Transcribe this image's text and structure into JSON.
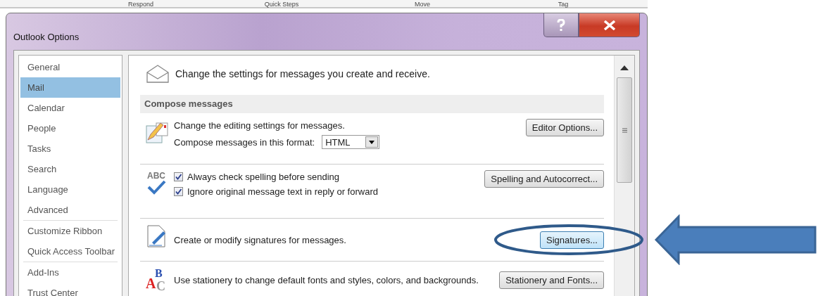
{
  "ribbon_groups": [
    "Respond",
    "Quick Steps",
    "Move",
    "Tag"
  ],
  "window": {
    "title": "Outlook Options"
  },
  "sidebar": {
    "groups": [
      [
        {
          "label": "General",
          "selected": false
        },
        {
          "label": "Mail",
          "selected": true
        },
        {
          "label": "Calendar",
          "selected": false
        },
        {
          "label": "People",
          "selected": false
        },
        {
          "label": "Tasks",
          "selected": false
        },
        {
          "label": "Search",
          "selected": false
        },
        {
          "label": "Language",
          "selected": false
        },
        {
          "label": "Advanced",
          "selected": false
        }
      ],
      [
        {
          "label": "Customize Ribbon",
          "selected": false
        },
        {
          "label": "Quick Access Toolbar",
          "selected": false
        }
      ],
      [
        {
          "label": "Add-Ins",
          "selected": false
        },
        {
          "label": "Trust Center",
          "selected": false
        }
      ]
    ]
  },
  "header": "Change the settings for messages you create and receive.",
  "section": "Compose messages",
  "rows": [
    {
      "lines": [
        {
          "kind": "text",
          "text": "Change the editing settings for messages."
        },
        {
          "kind": "select",
          "label": "Compose messages in this format:",
          "value": "HTML"
        }
      ],
      "button": {
        "label": "Editor Options...",
        "circled": false
      }
    },
    {
      "icon_letters": [
        "ABC"
      ],
      "lines": [
        {
          "kind": "checkbox",
          "label": "Always check spelling before sending",
          "checked": true
        },
        {
          "kind": "checkbox",
          "label": "Ignore original message text in reply or forward",
          "checked": true
        }
      ],
      "button": {
        "label": "Spelling and Autocorrect...",
        "circled": false
      }
    },
    {
      "lines": [
        {
          "kind": "text",
          "text": "Create or modify signatures for messages."
        }
      ],
      "button": {
        "label": "Signatures...",
        "circled": true
      }
    },
    {
      "icon_letters": [
        "B",
        "A",
        "C"
      ],
      "lines": [
        {
          "kind": "text",
          "text": "Use stationery to change default fonts and styles, colors, and backgrounds."
        }
      ],
      "button": {
        "label": "Stationery and Fonts...",
        "circled": false
      }
    }
  ]
}
